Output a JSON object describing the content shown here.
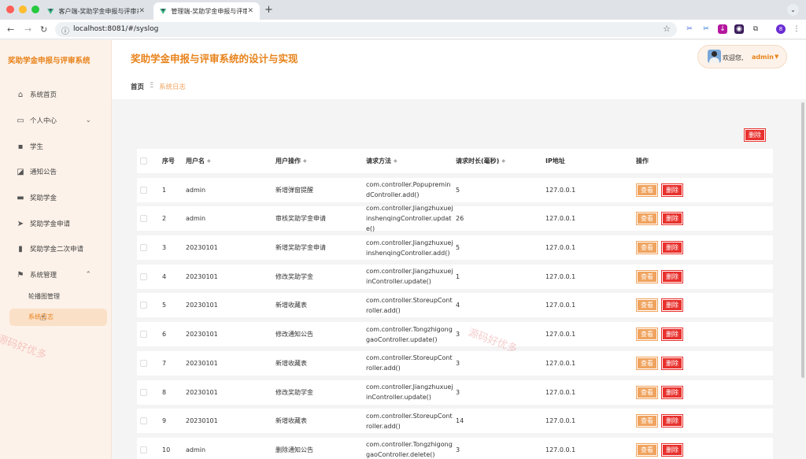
{
  "browser": {
    "tabs": [
      {
        "label": "客户端-奖助学金申报与评审系统"
      },
      {
        "label": "管理端-奖助学金申报与评审系统"
      }
    ],
    "url": "localhost:8081/#/syslog",
    "profile": "8"
  },
  "sidebar": {
    "brand": "奖助学金申报与评审系统",
    "items": [
      {
        "label": "系统首页",
        "icon": "home-icon"
      },
      {
        "label": "个人中心",
        "icon": "calendar-icon"
      },
      {
        "label": "学生",
        "icon": "chat-icon"
      },
      {
        "label": "通知公告",
        "icon": "chart-icon"
      },
      {
        "label": "奖助学金",
        "icon": "briefcase-icon"
      },
      {
        "label": "奖助学金申请",
        "icon": "send-icon"
      },
      {
        "label": "奖助学金二次申请",
        "icon": "bar-chart-icon"
      },
      {
        "label": "系统管理",
        "icon": "flag-icon"
      }
    ],
    "submenu": [
      {
        "label": "轮播图管理"
      },
      {
        "label": "系统日志"
      }
    ]
  },
  "header": {
    "title": "奖助学金申报与评审系统的设计与实现",
    "welcome": "欢迎您,",
    "username": "admin"
  },
  "breadcrumb": {
    "home": "首页",
    "separator": "Ξ",
    "current": "系统日志"
  },
  "toolbar": {
    "delete_label": "删除"
  },
  "table": {
    "columns": [
      "序号",
      "用户名",
      "用户操作",
      "请求方法",
      "请求时长(毫秒)",
      "IP地址",
      "操作"
    ],
    "view_label": "查看",
    "delete_label": "删除",
    "rows": [
      {
        "no": "1",
        "user": "admin",
        "op": "新增弹窗提醒",
        "method": "com.controller.PopupremindController.add()",
        "time": "5",
        "ip": "127.0.0.1"
      },
      {
        "no": "2",
        "user": "admin",
        "op": "审核奖助学金申请",
        "method": "com.controller.JiangzhuxuejinshenqingController.update()",
        "time": "26",
        "ip": "127.0.0.1"
      },
      {
        "no": "3",
        "user": "20230101",
        "op": "新增奖助学金申请",
        "method": "com.controller.JiangzhuxuejinshenqingController.add()",
        "time": "5",
        "ip": "127.0.0.1"
      },
      {
        "no": "4",
        "user": "20230101",
        "op": "修改奖助学金",
        "method": "com.controller.JiangzhuxuejinController.update()",
        "time": "1",
        "ip": "127.0.0.1"
      },
      {
        "no": "5",
        "user": "20230101",
        "op": "新增收藏表",
        "method": "com.controller.StoreupController.add()",
        "time": "4",
        "ip": "127.0.0.1"
      },
      {
        "no": "6",
        "user": "20230101",
        "op": "修改通知公告",
        "method": "com.controller.TongzhigonggaoController.update()",
        "time": "3",
        "ip": "127.0.0.1"
      },
      {
        "no": "7",
        "user": "20230101",
        "op": "新增收藏表",
        "method": "com.controller.StoreupController.add()",
        "time": "3",
        "ip": "127.0.0.1"
      },
      {
        "no": "8",
        "user": "20230101",
        "op": "修改奖助学金",
        "method": "com.controller.JiangzhuxuejinController.update()",
        "time": "3",
        "ip": "127.0.0.1"
      },
      {
        "no": "9",
        "user": "20230101",
        "op": "新增收藏表",
        "method": "com.controller.StoreupController.add()",
        "time": "14",
        "ip": "127.0.0.1"
      },
      {
        "no": "10",
        "user": "admin",
        "op": "删除通知公告",
        "method": "com.controller.TongzhigonggaoController.delete()",
        "time": "3",
        "ip": "127.0.0.1"
      }
    ]
  },
  "watermark": "源码好优多",
  "colors": {
    "accent": "#e8831c",
    "danger": "#e8312d",
    "view": "#f0a35e"
  }
}
